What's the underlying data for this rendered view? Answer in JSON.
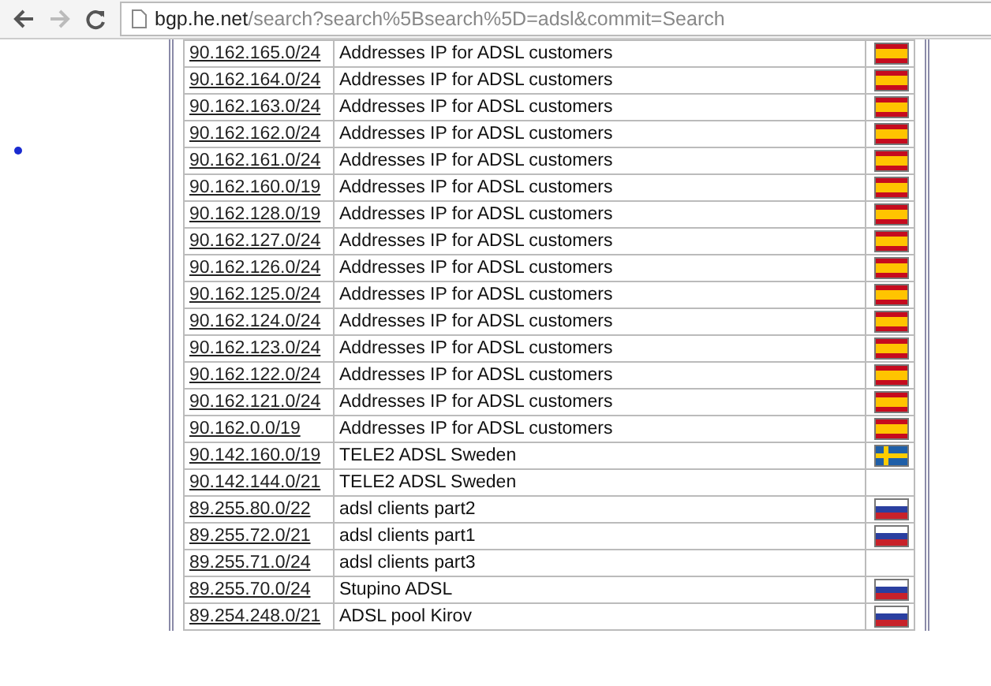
{
  "browser": {
    "url_host": "bgp.he.net",
    "url_path": "/search?search%5Bsearch%5D=adsl&commit=Search"
  },
  "rows": [
    {
      "prefix": "90.162.165.0/24",
      "description": "Addresses IP for ADSL customers",
      "kind": "spain"
    },
    {
      "prefix": "90.162.164.0/24",
      "description": "Addresses IP for ADSL customers",
      "kind": "spain"
    },
    {
      "prefix": "90.162.163.0/24",
      "description": "Addresses IP for ADSL customers",
      "kind": "spain"
    },
    {
      "prefix": "90.162.162.0/24",
      "description": "Addresses IP for ADSL customers",
      "kind": "spain"
    },
    {
      "prefix": "90.162.161.0/24",
      "description": "Addresses IP for ADSL customers",
      "kind": "spain"
    },
    {
      "prefix": "90.162.160.0/19",
      "description": "Addresses IP for ADSL customers",
      "kind": "spain"
    },
    {
      "prefix": "90.162.128.0/19",
      "description": "Addresses IP for ADSL customers",
      "kind": "spain"
    },
    {
      "prefix": "90.162.127.0/24",
      "description": "Addresses IP for ADSL customers",
      "kind": "spain"
    },
    {
      "prefix": "90.162.126.0/24",
      "description": "Addresses IP for ADSL customers",
      "kind": "spain"
    },
    {
      "prefix": "90.162.125.0/24",
      "description": "Addresses IP for ADSL customers",
      "kind": "spain"
    },
    {
      "prefix": "90.162.124.0/24",
      "description": "Addresses IP for ADSL customers",
      "kind": "spain"
    },
    {
      "prefix": "90.162.123.0/24",
      "description": "Addresses IP for ADSL customers",
      "kind": "spain"
    },
    {
      "prefix": "90.162.122.0/24",
      "description": "Addresses IP for ADSL customers",
      "kind": "spain"
    },
    {
      "prefix": "90.162.121.0/24",
      "description": "Addresses IP for ADSL customers",
      "kind": "spain"
    },
    {
      "prefix": "90.162.0.0/19",
      "description": "Addresses IP for ADSL customers",
      "kind": "spain"
    },
    {
      "prefix": "90.142.160.0/19",
      "description": "TELE2 ADSL Sweden",
      "kind": "sweden"
    },
    {
      "prefix": "90.142.144.0/21",
      "description": "TELE2 ADSL Sweden",
      "kind": "plain"
    },
    {
      "prefix": "89.255.80.0/22",
      "description": "adsl clients part2",
      "kind": "russia"
    },
    {
      "prefix": "89.255.72.0/21",
      "description": "adsl clients part1",
      "kind": "russia"
    },
    {
      "prefix": "89.255.71.0/24",
      "description": "adsl clients part3",
      "kind": "plain"
    },
    {
      "prefix": "89.255.70.0/24",
      "description": "Stupino ADSL",
      "kind": "russia"
    },
    {
      "prefix": "89.254.248.0/21",
      "description": "ADSL pool Kirov",
      "kind": "russia"
    }
  ]
}
